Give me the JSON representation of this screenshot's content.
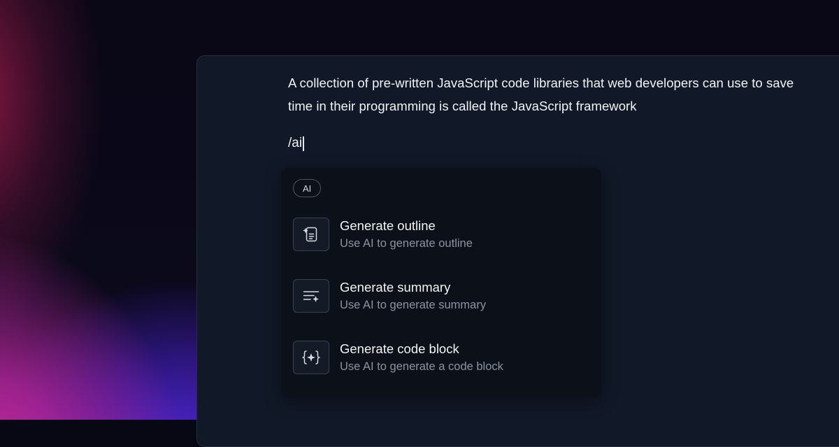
{
  "editor": {
    "paragraph": "A collection of pre-written JavaScript code libraries that web developers can use to save time in their programming is called the JavaScript framework",
    "command": "/ai"
  },
  "ai_menu": {
    "badge": "AI",
    "items": [
      {
        "title": "Generate outline",
        "description": "Use AI to generate outline",
        "icon": "outline-sparkle-icon"
      },
      {
        "title": "Generate summary",
        "description": "Use AI to generate summary",
        "icon": "summary-sparkle-icon"
      },
      {
        "title": "Generate code block",
        "description": "Use AI to generate a code block",
        "icon": "code-braces-sparkle-icon"
      }
    ]
  },
  "colors": {
    "panel_background": "#111827",
    "menu_background": "#0c1119",
    "text_primary": "#f3f4f6",
    "text_secondary": "#8b93a1",
    "icon_stroke": "#d6dbe4",
    "background_magenta": "#ec34a8",
    "background_violet": "#5228dc"
  }
}
